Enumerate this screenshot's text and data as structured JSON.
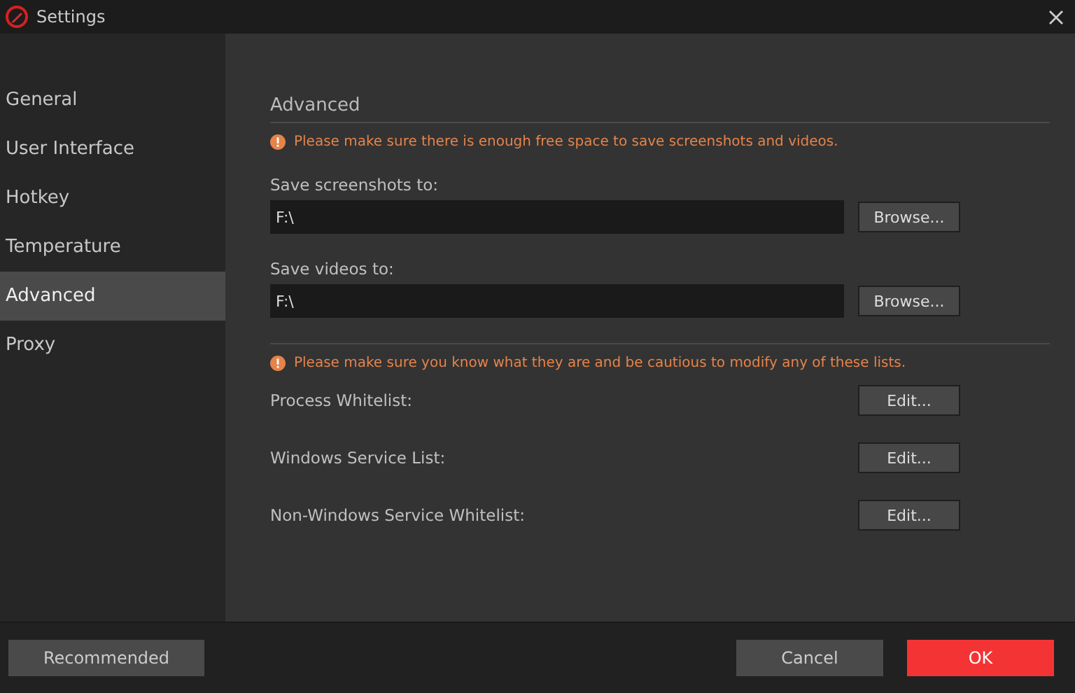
{
  "window": {
    "title": "Settings"
  },
  "sidebar": {
    "items": [
      {
        "label": "General",
        "selected": false
      },
      {
        "label": "User Interface",
        "selected": false
      },
      {
        "label": "Hotkey",
        "selected": false
      },
      {
        "label": "Temperature",
        "selected": false
      },
      {
        "label": "Advanced",
        "selected": true
      },
      {
        "label": "Proxy",
        "selected": false
      }
    ]
  },
  "section": {
    "title": "Advanced",
    "storage_warning": "Please make sure there is enough free space to save screenshots and videos.",
    "paths": [
      {
        "label": "Save screenshots to:",
        "value": "F:\\",
        "button": "Browse..."
      },
      {
        "label": "Save videos to:",
        "value": "F:\\",
        "button": "Browse..."
      }
    ],
    "lists_warning": "Please make sure you know what they are and be cautious to modify any of these lists.",
    "lists": [
      {
        "label": "Process Whitelist:",
        "button": "Edit..."
      },
      {
        "label": "Windows Service List:",
        "button": "Edit..."
      },
      {
        "label": "Non-Windows Service Whitelist:",
        "button": "Edit..."
      }
    ]
  },
  "footer": {
    "recommended": "Recommended",
    "cancel": "Cancel",
    "ok": "OK"
  }
}
